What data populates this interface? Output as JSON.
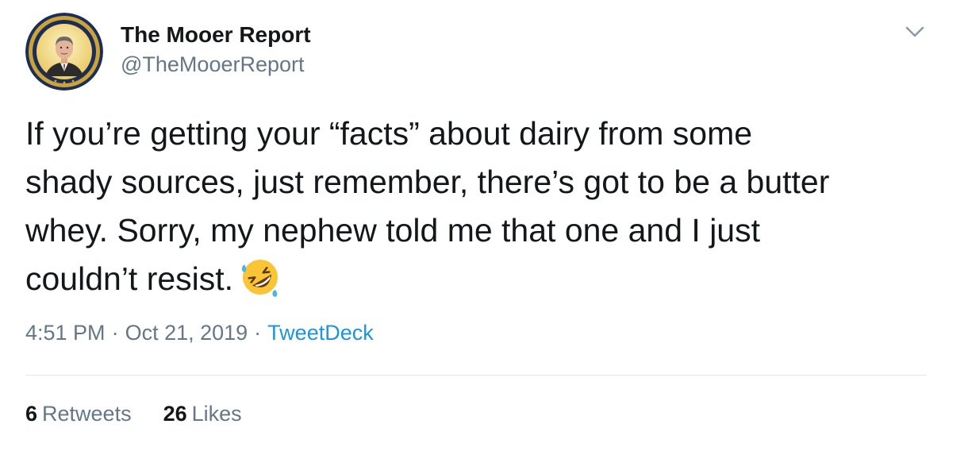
{
  "user": {
    "display_name": "The Mooer Report",
    "handle": "@TheMooerReport",
    "avatar_icon": "seal-portrait-avatar"
  },
  "tweet": {
    "lines": [
      "If you’re getting your “facts” about dairy from some",
      "shady sources, just remember, there’s got to be a butter",
      "whey. Sorry, my nephew told me that one and I just",
      "couldn’t resist."
    ],
    "emoji": "rolling-on-the-floor-laughing-emoji"
  },
  "meta": {
    "time": "4:51 PM",
    "separator": "·",
    "date": "Oct 21, 2019",
    "source": "TweetDeck"
  },
  "stats": {
    "retweets": {
      "count": "6",
      "label": "Retweets"
    },
    "likes": {
      "count": "26",
      "label": "Likes"
    }
  },
  "colors": {
    "text": "#14171a",
    "secondary": "#657786",
    "link": "#1b95e0",
    "divider": "#e1e8ed"
  }
}
